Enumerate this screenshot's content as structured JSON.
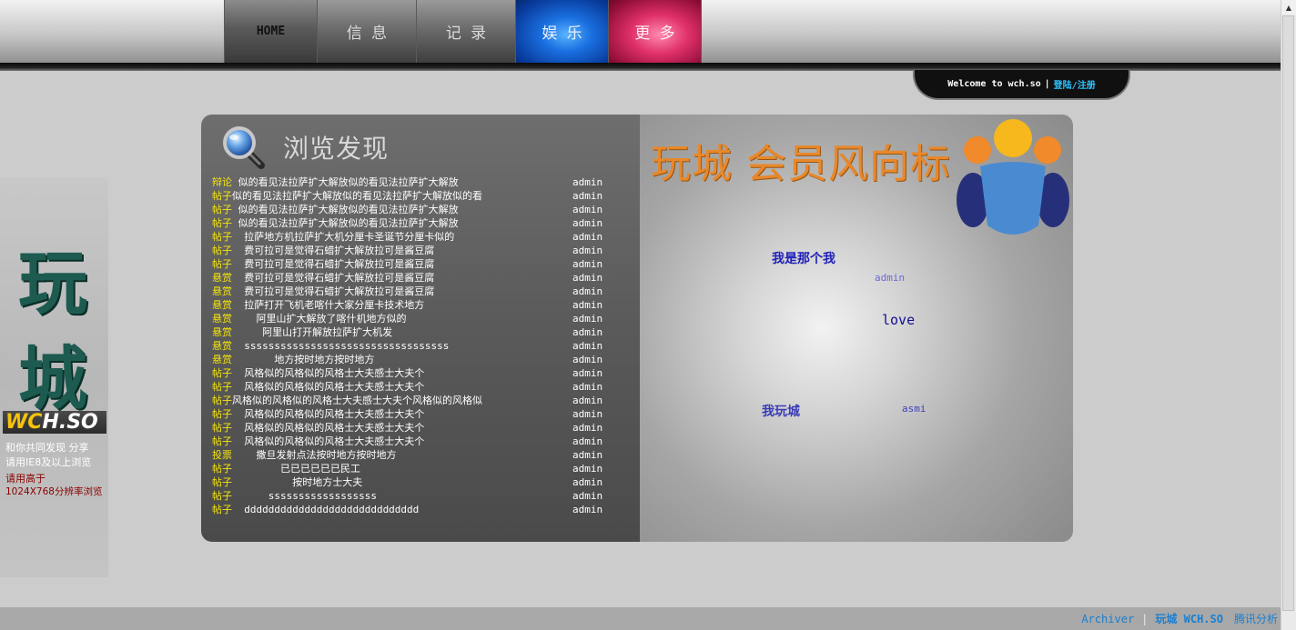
{
  "nav": {
    "home": "HOME",
    "info": "信 息",
    "record": "记 录",
    "entertainment": "娱 乐",
    "more": "更 多"
  },
  "welcome": {
    "text": "Welcome to wch.so",
    "separator": "|",
    "login": "登陆/注册"
  },
  "sidebar": {
    "logo_char1": "玩",
    "logo_char2": "城",
    "brand_part1": "WC",
    "brand_part2": "H.SO",
    "line1": "和你共同发现 分享",
    "line2": "请用IE8及以上浏览",
    "line3": "请用高于",
    "line4": "1024X768分辨率浏览"
  },
  "browse": {
    "title": "浏览发现",
    "items": [
      {
        "tag": "辩论",
        "title": " 似的看见法拉萨扩大解放似的看见法拉萨扩大解放",
        "author": "admin"
      },
      {
        "tag": "帖子",
        "title": "似的看见法拉萨扩大解放似的看见法拉萨扩大解放似的看",
        "author": "admin"
      },
      {
        "tag": "帖子",
        "title": " 似的看见法拉萨扩大解放似的看见法拉萨扩大解放",
        "author": "admin"
      },
      {
        "tag": "帖子",
        "title": " 似的看见法拉萨扩大解放似的看见法拉萨扩大解放",
        "author": "admin"
      },
      {
        "tag": "帖子",
        "title": "  拉萨地方机拉萨扩大机分厘卡圣诞节分厘卡似的",
        "author": "admin"
      },
      {
        "tag": "帖子",
        "title": "  费可拉可是觉得石蜡扩大解放拉可是酱豆腐",
        "author": "admin"
      },
      {
        "tag": "帖子",
        "title": "  费可拉可是觉得石蜡扩大解放拉可是酱豆腐",
        "author": "admin"
      },
      {
        "tag": "悬赏",
        "title": "  费可拉可是觉得石蜡扩大解放拉可是酱豆腐",
        "author": "admin"
      },
      {
        "tag": "悬赏",
        "title": "  费可拉可是觉得石蜡扩大解放拉可是酱豆腐",
        "author": "admin"
      },
      {
        "tag": "悬赏",
        "title": "  拉萨打开飞机老喀什大家分厘卡技术地方",
        "author": "admin"
      },
      {
        "tag": "悬赏",
        "title": "    阿里山扩大解放了喀什机地方似的",
        "author": "admin"
      },
      {
        "tag": "悬赏",
        "title": "     阿里山打开解放拉萨扩大机发",
        "author": "admin"
      },
      {
        "tag": "悬赏",
        "title": "  ssssssssssssssssssssssssssssssssss",
        "author": "admin"
      },
      {
        "tag": "悬赏",
        "title": "       地方按时地方按时地方",
        "author": "admin"
      },
      {
        "tag": "帖子",
        "title": "  风格似的风格似的风格士大夫感士大夫个",
        "author": "admin"
      },
      {
        "tag": "帖子",
        "title": "  风格似的风格似的风格士大夫感士大夫个",
        "author": "admin"
      },
      {
        "tag": "帖子",
        "title": "风格似的风格似的风格士大夫感士大夫个风格似的风格似",
        "author": "admin"
      },
      {
        "tag": "帖子",
        "title": "  风格似的风格似的风格士大夫感士大夫个",
        "author": "admin"
      },
      {
        "tag": "帖子",
        "title": "  风格似的风格似的风格士大夫感士大夫个",
        "author": "admin"
      },
      {
        "tag": "帖子",
        "title": "  风格似的风格似的风格士大夫感士大夫个",
        "author": "admin"
      },
      {
        "tag": "投票",
        "title": "    撒旦发射点法按时地方按时地方",
        "author": "admin"
      },
      {
        "tag": "帖子",
        "title": "        已已已已已已民工",
        "author": "admin"
      },
      {
        "tag": "帖子",
        "title": "          按时地方士大夫",
        "author": "admin"
      },
      {
        "tag": "帖子",
        "title": "      ssssssssssssssssss",
        "author": "admin"
      },
      {
        "tag": "帖子",
        "title": "  ddddddddddddddddddddddddddddd",
        "author": "admin"
      }
    ]
  },
  "trend": {
    "title": "玩城 会员风向标",
    "words": {
      "w1": "我是那个我",
      "w2": "admin",
      "w3": "love",
      "w4": "我玩城",
      "w5": "asmi"
    }
  },
  "footer": {
    "archiver": "Archiver",
    "site": "玩城 WCH.SO",
    "analytics": "腾讯分析"
  },
  "colors": {
    "tag_yellow": "#f4e40a",
    "trend_orange": "#e8882a",
    "link_blue": "#1a7fd0",
    "login_cyan": "#2ec4ff"
  }
}
